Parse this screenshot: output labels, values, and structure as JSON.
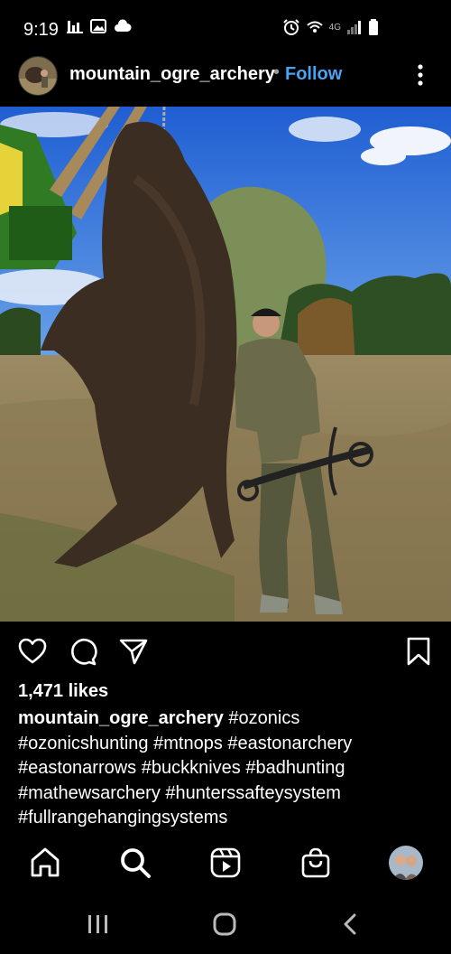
{
  "status_bar": {
    "time": "9:19",
    "network": "4G"
  },
  "post": {
    "username": "mountain_ogre_archery",
    "separator": "•",
    "follow_label": "Follow",
    "likes": "1,471 likes",
    "caption_user": "mountain_ogre_archery",
    "caption_lines": [
      "#ozonics",
      "#ozonicshunting #mtnops #eastonarchery",
      "#eastonarrows #buckknives #badhunting",
      "#mathewsarchery #hunterssafteysystem",
      "#fullrangehangingsystems"
    ]
  },
  "icons": {
    "actions": [
      "heart-icon",
      "comment-icon",
      "share-icon",
      "bookmark-icon"
    ],
    "bottom_nav": [
      "home-icon",
      "search-icon",
      "reels-icon",
      "shop-icon",
      "profile-avatar"
    ],
    "system_nav": [
      "recents-icon",
      "home-circle-icon",
      "back-icon"
    ]
  },
  "colors": {
    "background": "#000000",
    "text": "#ffffff",
    "follow": "#4aa3f0",
    "secondary": "#9a9a9a"
  }
}
